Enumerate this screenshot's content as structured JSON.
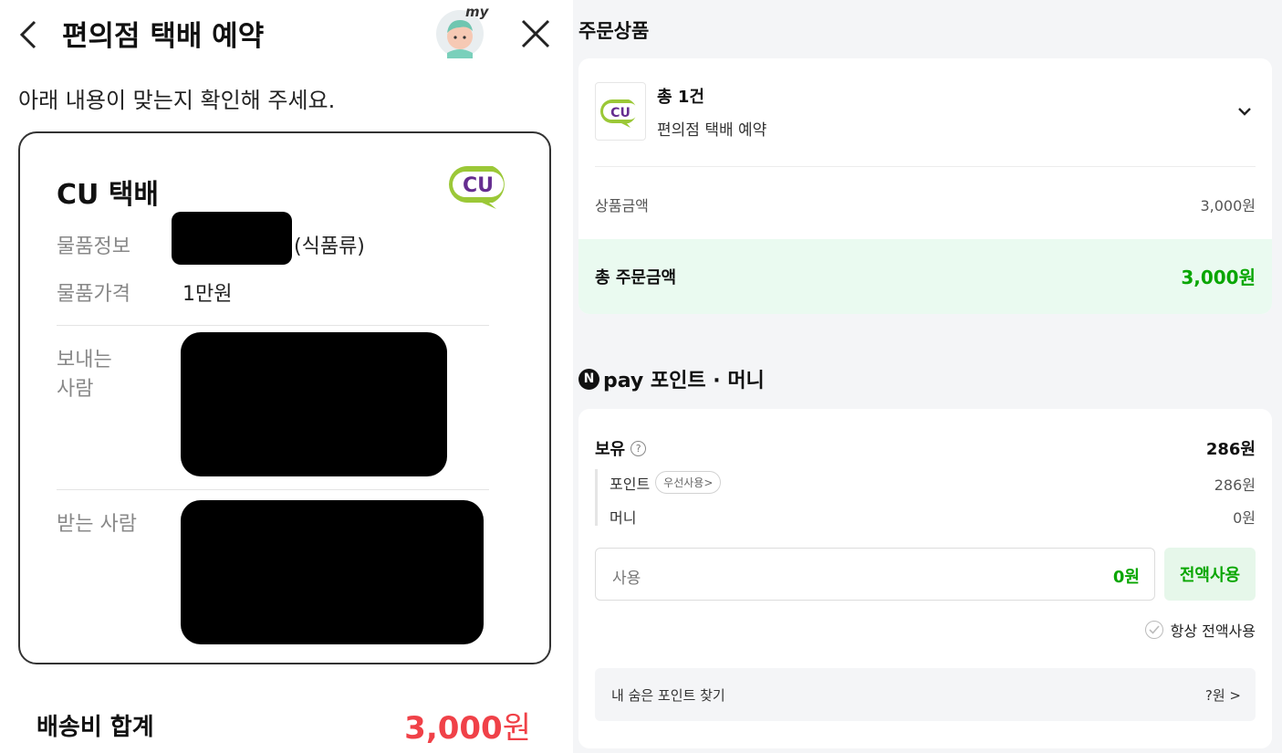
{
  "left": {
    "title": "편의점 택배 예약",
    "my_badge": "my",
    "instruction": "아래 내용이 맞는지 확인해 주세요.",
    "card": {
      "carrier": "CU 택배",
      "logo_text": "CU",
      "item_info_label": "물품정보",
      "item_info_suffix": "(식품류)",
      "item_price_label": "물품가격",
      "item_price_value": "1만원",
      "sender_label_line1": "보내는",
      "sender_label_line2": "사람",
      "receiver_label": "받는 사람"
    },
    "shipping_total_label": "배송비 합계",
    "shipping_total_number": "3,000",
    "shipping_total_unit": "원"
  },
  "right": {
    "order_section_title": "주문상품",
    "order": {
      "count": "총 1건",
      "product_name": "편의점 택배 예약",
      "thumb_text": "CU",
      "price_label": "상품금액",
      "price_value": "3,000원",
      "total_label": "총 주문금액",
      "total_value": "3,000원"
    },
    "npay": {
      "badge": "N",
      "title": "pay 포인트 · 머니",
      "hold_label": "보유",
      "hold_value": "286원",
      "point_label": "포인트",
      "point_pill": "우선사용>",
      "point_value": "286원",
      "money_label": "머니",
      "money_value": "0원",
      "use_placeholder": "사용",
      "use_value": "0원",
      "use_all_button": "전액사용",
      "always_use_label": "항상 전액사용",
      "hidden_point_label": "내 숨은 포인트 찾기",
      "hidden_point_value": "?원 >"
    }
  },
  "colors": {
    "accent_green": "#08a600",
    "total_bg": "#eafaf0",
    "shipping_red": "#f04148",
    "cu_green": "#9bc837",
    "cu_purple": "#652d90"
  }
}
